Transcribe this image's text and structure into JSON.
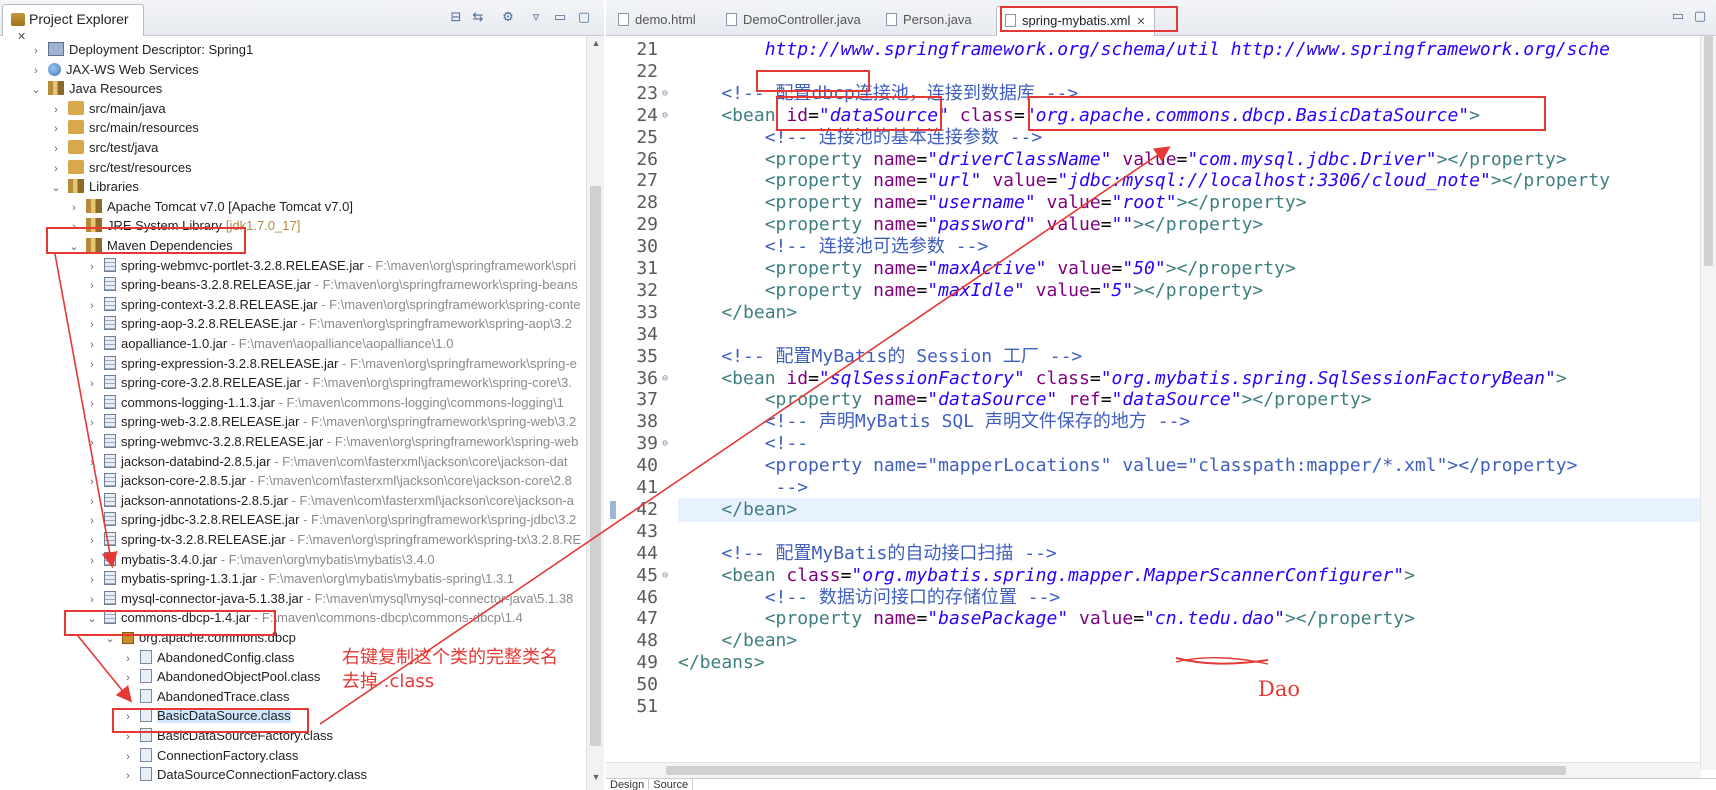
{
  "explorer": {
    "title": "Project Explorer",
    "tools": [
      "collapse-all-icon",
      "link-editor-icon",
      "filters-icon",
      "view-menu-icon",
      "minimize-icon",
      "maximize-icon"
    ],
    "rows": [
      {
        "label": "Deployment Descriptor: Spring1",
        "path": "",
        "deco": "",
        "icon": "deployment-descriptor-icon",
        "arrow": "›"
      },
      {
        "label": "JAX-WS Web Services",
        "path": "",
        "deco": "",
        "icon": "web-services-icon",
        "arrow": "›"
      },
      {
        "label": "Java Resources",
        "path": "",
        "deco": "",
        "icon": "java-resources-icon",
        "arrow": "⌄"
      },
      {
        "label": "src/main/java",
        "path": "",
        "deco": "",
        "icon": "source-folder-icon",
        "arrow": "›"
      },
      {
        "label": "src/main/resources",
        "path": "",
        "deco": "",
        "icon": "source-folder-icon",
        "arrow": "›"
      },
      {
        "label": "src/test/java",
        "path": "",
        "deco": "",
        "icon": "source-folder-icon",
        "arrow": "›"
      },
      {
        "label": "src/test/resources",
        "path": "",
        "deco": "",
        "icon": "source-folder-icon",
        "arrow": "›"
      },
      {
        "label": "Libraries",
        "path": "",
        "deco": "",
        "icon": "libraries-icon",
        "arrow": "⌄"
      },
      {
        "label": "Apache Tomcat v7.0 [Apache Tomcat v7.0]",
        "path": "",
        "deco": "",
        "icon": "library-icon",
        "arrow": "›"
      },
      {
        "label": "JRE System Library",
        "path": "",
        "deco": "[jdk1.7.0_17]",
        "icon": "library-icon",
        "arrow": "›"
      },
      {
        "label": "Maven Dependencies",
        "path": "",
        "deco": "",
        "icon": "library-icon",
        "arrow": "⌄"
      },
      {
        "label": "spring-webmvc-portlet-3.2.8.RELEASE.jar",
        "path": " - F:\\maven\\org\\springframework\\spri",
        "deco": "",
        "icon": "jar-icon",
        "arrow": "›"
      },
      {
        "label": "spring-beans-3.2.8.RELEASE.jar",
        "path": " - F:\\maven\\org\\springframework\\spring-beans",
        "deco": "",
        "icon": "jar-icon",
        "arrow": "›"
      },
      {
        "label": "spring-context-3.2.8.RELEASE.jar",
        "path": " - F:\\maven\\org\\springframework\\spring-conte",
        "deco": "",
        "icon": "jar-icon",
        "arrow": "›"
      },
      {
        "label": "spring-aop-3.2.8.RELEASE.jar",
        "path": " - F:\\maven\\org\\springframework\\spring-aop\\3.2",
        "deco": "",
        "icon": "jar-icon",
        "arrow": "›"
      },
      {
        "label": "aopalliance-1.0.jar",
        "path": " - F:\\maven\\aopalliance\\aopalliance\\1.0",
        "deco": "",
        "icon": "jar-icon",
        "arrow": "›"
      },
      {
        "label": "spring-expression-3.2.8.RELEASE.jar",
        "path": " - F:\\maven\\org\\springframework\\spring-e",
        "deco": "",
        "icon": "jar-icon",
        "arrow": "›"
      },
      {
        "label": "spring-core-3.2.8.RELEASE.jar",
        "path": " - F:\\maven\\org\\springframework\\spring-core\\3.",
        "deco": "",
        "icon": "jar-icon",
        "arrow": "›"
      },
      {
        "label": "commons-logging-1.1.3.jar",
        "path": " - F:\\maven\\commons-logging\\commons-logging\\1",
        "deco": "",
        "icon": "jar-icon",
        "arrow": "›"
      },
      {
        "label": "spring-web-3.2.8.RELEASE.jar",
        "path": " - F:\\maven\\org\\springframework\\spring-web\\3.2",
        "deco": "",
        "icon": "jar-icon",
        "arrow": "›"
      },
      {
        "label": "spring-webmvc-3.2.8.RELEASE.jar",
        "path": " - F:\\maven\\org\\springframework\\spring-web",
        "deco": "",
        "icon": "jar-icon",
        "arrow": "›"
      },
      {
        "label": "jackson-databind-2.8.5.jar",
        "path": " - F:\\maven\\com\\fasterxml\\jackson\\core\\jackson-dat",
        "deco": "",
        "icon": "jar-icon",
        "arrow": "›"
      },
      {
        "label": "jackson-core-2.8.5.jar",
        "path": " - F:\\maven\\com\\fasterxml\\jackson\\core\\jackson-core\\2.8",
        "deco": "",
        "icon": "jar-icon",
        "arrow": "›"
      },
      {
        "label": "jackson-annotations-2.8.5.jar",
        "path": " - F:\\maven\\com\\fasterxml\\jackson\\core\\jackson-a",
        "deco": "",
        "icon": "jar-icon",
        "arrow": "›"
      },
      {
        "label": "spring-jdbc-3.2.8.RELEASE.jar",
        "path": " - F:\\maven\\org\\springframework\\spring-jdbc\\3.2",
        "deco": "",
        "icon": "jar-icon",
        "arrow": "›"
      },
      {
        "label": "spring-tx-3.2.8.RELEASE.jar",
        "path": " - F:\\maven\\org\\springframework\\spring-tx\\3.2.8.RE",
        "deco": "",
        "icon": "jar-icon",
        "arrow": "›"
      },
      {
        "label": "mybatis-3.4.0.jar",
        "path": " - F:\\maven\\org\\mybatis\\mybatis\\3.4.0",
        "deco": "",
        "icon": "jar-icon",
        "arrow": "›"
      },
      {
        "label": "mybatis-spring-1.3.1.jar",
        "path": " - F:\\maven\\org\\mybatis\\mybatis-spring\\1.3.1",
        "deco": "",
        "icon": "jar-icon",
        "arrow": "›"
      },
      {
        "label": "mysql-connector-java-5.1.38.jar",
        "path": " - F:\\maven\\mysql\\mysql-connector-java\\5.1.38",
        "deco": "",
        "icon": "jar-icon",
        "arrow": "›"
      },
      {
        "label": "commons-dbcp-1.4.jar",
        "path": " - F:\\maven\\commons-dbcp\\commons-dbcp\\1.4",
        "deco": "",
        "icon": "jar-icon",
        "arrow": "⌄"
      },
      {
        "label": "org.apache.commons.dbcp",
        "path": "",
        "deco": "",
        "icon": "package-icon",
        "arrow": "⌄"
      },
      {
        "label": "AbandonedConfig.class",
        "path": "",
        "deco": "",
        "icon": "class-file-icon",
        "arrow": "›"
      },
      {
        "label": "AbandonedObjectPool.class",
        "path": "",
        "deco": "",
        "icon": "class-file-icon",
        "arrow": "›"
      },
      {
        "label": "AbandonedTrace.class",
        "path": "",
        "deco": "",
        "icon": "class-file-icon",
        "arrow": "›"
      },
      {
        "label": "BasicDataSource.class",
        "path": "",
        "deco": "",
        "icon": "class-file-icon",
        "arrow": "›"
      },
      {
        "label": "BasicDataSourceFactory.class",
        "path": "",
        "deco": "",
        "icon": "class-file-icon",
        "arrow": "›"
      },
      {
        "label": "ConnectionFactory.class",
        "path": "",
        "deco": "",
        "icon": "class-file-icon",
        "arrow": "›"
      },
      {
        "label": "DataSourceConnectionFactory.class",
        "path": "",
        "deco": "",
        "icon": "class-file-icon",
        "arrow": "›"
      }
    ]
  },
  "editor": {
    "tabs": [
      {
        "label": "demo.html",
        "active": false
      },
      {
        "label": "DemoController.java",
        "active": false
      },
      {
        "label": "Person.java",
        "active": false
      },
      {
        "label": "spring-mybatis.xml",
        "active": true
      }
    ],
    "bottom_tabs": [
      "Design",
      "Source"
    ],
    "lines": [
      {
        "n": "21",
        "fold": "",
        "cur": false,
        "segs": [
          [
            "link",
            "        http://www.springframework.org/schema/util http://www.springframework.org/sche"
          ]
        ]
      },
      {
        "n": "22",
        "fold": "",
        "cur": false,
        "segs": []
      },
      {
        "n": "23",
        "fold": "⊖",
        "cur": false,
        "segs": [
          [
            "comm",
            "    <!-- 配置dbcp连接池，连接到数据库 -->"
          ]
        ]
      },
      {
        "n": "24",
        "fold": "⊖",
        "cur": false,
        "segs": [
          [
            "tag",
            "    <bean "
          ],
          [
            "attr",
            "id"
          ],
          [
            "plain",
            "="
          ],
          [
            "str",
            "\"dataSource\""
          ],
          [
            "plain",
            " "
          ],
          [
            "attr",
            "class"
          ],
          [
            "plain",
            "="
          ],
          [
            "str",
            "\"org.apache.commons.dbcp.BasicDataSource\""
          ],
          [
            "tag",
            ">"
          ]
        ]
      },
      {
        "n": "25",
        "fold": "",
        "cur": false,
        "segs": [
          [
            "comm",
            "        <!-- 连接池的基本连接参数 -->"
          ]
        ]
      },
      {
        "n": "26",
        "fold": "",
        "cur": false,
        "segs": [
          [
            "tag",
            "        <property "
          ],
          [
            "attr",
            "name"
          ],
          [
            "plain",
            "="
          ],
          [
            "str",
            "\"driverClassName\""
          ],
          [
            "plain",
            " "
          ],
          [
            "attr",
            "value"
          ],
          [
            "plain",
            "="
          ],
          [
            "str",
            "\"com.mysql.jdbc.Driver\""
          ],
          [
            "tag",
            "></property>"
          ]
        ]
      },
      {
        "n": "27",
        "fold": "",
        "cur": false,
        "segs": [
          [
            "tag",
            "        <property "
          ],
          [
            "attr",
            "name"
          ],
          [
            "plain",
            "="
          ],
          [
            "str",
            "\"url\""
          ],
          [
            "plain",
            " "
          ],
          [
            "attr",
            "value"
          ],
          [
            "plain",
            "="
          ],
          [
            "str",
            "\"jdbc:mysql://localhost:3306/cloud_note\""
          ],
          [
            "tag",
            "></property"
          ]
        ]
      },
      {
        "n": "28",
        "fold": "",
        "cur": false,
        "segs": [
          [
            "tag",
            "        <property "
          ],
          [
            "attr",
            "name"
          ],
          [
            "plain",
            "="
          ],
          [
            "str",
            "\"username\""
          ],
          [
            "plain",
            " "
          ],
          [
            "attr",
            "value"
          ],
          [
            "plain",
            "="
          ],
          [
            "str",
            "\"root\""
          ],
          [
            "tag",
            "></property>"
          ]
        ]
      },
      {
        "n": "29",
        "fold": "",
        "cur": false,
        "segs": [
          [
            "tag",
            "        <property "
          ],
          [
            "attr",
            "name"
          ],
          [
            "plain",
            "="
          ],
          [
            "str",
            "\"password\""
          ],
          [
            "plain",
            " "
          ],
          [
            "attr",
            "value"
          ],
          [
            "plain",
            "="
          ],
          [
            "str",
            "\"\""
          ],
          [
            "tag",
            "></property>"
          ]
        ]
      },
      {
        "n": "30",
        "fold": "",
        "cur": false,
        "segs": [
          [
            "comm",
            "        <!-- 连接池可选参数 -->"
          ]
        ]
      },
      {
        "n": "31",
        "fold": "",
        "cur": false,
        "segs": [
          [
            "tag",
            "        <property "
          ],
          [
            "attr",
            "name"
          ],
          [
            "plain",
            "="
          ],
          [
            "str",
            "\"maxActive\""
          ],
          [
            "plain",
            " "
          ],
          [
            "attr",
            "value"
          ],
          [
            "plain",
            "="
          ],
          [
            "str",
            "\"50\""
          ],
          [
            "tag",
            "></property>"
          ]
        ]
      },
      {
        "n": "32",
        "fold": "",
        "cur": false,
        "segs": [
          [
            "tag",
            "        <property "
          ],
          [
            "attr",
            "name"
          ],
          [
            "plain",
            "="
          ],
          [
            "str",
            "\"maxIdle\""
          ],
          [
            "plain",
            " "
          ],
          [
            "attr",
            "value"
          ],
          [
            "plain",
            "="
          ],
          [
            "str",
            "\"5\""
          ],
          [
            "tag",
            "></property>"
          ]
        ]
      },
      {
        "n": "33",
        "fold": "",
        "cur": false,
        "segs": [
          [
            "tag",
            "    </bean>"
          ]
        ]
      },
      {
        "n": "34",
        "fold": "",
        "cur": false,
        "segs": []
      },
      {
        "n": "35",
        "fold": "",
        "cur": false,
        "segs": [
          [
            "comm",
            "    <!-- 配置MyBatis的 Session 工厂 -->"
          ]
        ]
      },
      {
        "n": "36",
        "fold": "⊖",
        "cur": false,
        "segs": [
          [
            "tag",
            "    <bean "
          ],
          [
            "attr",
            "id"
          ],
          [
            "plain",
            "="
          ],
          [
            "str",
            "\"sqlSessionFactory\""
          ],
          [
            "plain",
            " "
          ],
          [
            "attr",
            "class"
          ],
          [
            "plain",
            "="
          ],
          [
            "str",
            "\"org.mybatis.spring.SqlSessionFactoryBean\""
          ],
          [
            "tag",
            ">"
          ]
        ]
      },
      {
        "n": "37",
        "fold": "",
        "cur": false,
        "segs": [
          [
            "tag",
            "        <property "
          ],
          [
            "attr",
            "name"
          ],
          [
            "plain",
            "="
          ],
          [
            "str",
            "\"dataSource\""
          ],
          [
            "plain",
            " "
          ],
          [
            "attr",
            "ref"
          ],
          [
            "plain",
            "="
          ],
          [
            "str",
            "\"dataSource\""
          ],
          [
            "tag",
            "></property>"
          ]
        ]
      },
      {
        "n": "38",
        "fold": "",
        "cur": false,
        "segs": [
          [
            "comm",
            "        <!-- 声明MyBatis SQL 声明文件保存的地方 -->"
          ]
        ]
      },
      {
        "n": "39",
        "fold": "⊖",
        "cur": false,
        "segs": [
          [
            "comm",
            "        <!--"
          ]
        ]
      },
      {
        "n": "40",
        "fold": "",
        "cur": false,
        "segs": [
          [
            "comm",
            "        <property name=\"mapperLocations\" value=\"classpath:mapper/*.xml\"></property>"
          ]
        ]
      },
      {
        "n": "41",
        "fold": "",
        "cur": false,
        "segs": [
          [
            "comm",
            "         -->"
          ]
        ]
      },
      {
        "n": "42",
        "fold": "",
        "cur": true,
        "segs": [
          [
            "tag",
            "    </bean>"
          ]
        ]
      },
      {
        "n": "43",
        "fold": "",
        "cur": false,
        "segs": []
      },
      {
        "n": "44",
        "fold": "",
        "cur": false,
        "segs": [
          [
            "comm",
            "    <!-- 配置MyBatis的自动接口扫描 -->"
          ]
        ]
      },
      {
        "n": "45",
        "fold": "⊖",
        "cur": false,
        "segs": [
          [
            "tag",
            "    <bean "
          ],
          [
            "attr",
            "class"
          ],
          [
            "plain",
            "="
          ],
          [
            "str",
            "\"org.mybatis.spring.mapper.MapperScannerConfigurer\""
          ],
          [
            "tag",
            ">"
          ]
        ]
      },
      {
        "n": "46",
        "fold": "",
        "cur": false,
        "segs": [
          [
            "comm",
            "        <!-- 数据访问接口的存储位置 -->"
          ]
        ]
      },
      {
        "n": "47",
        "fold": "",
        "cur": false,
        "segs": [
          [
            "tag",
            "        <property "
          ],
          [
            "attr",
            "name"
          ],
          [
            "plain",
            "="
          ],
          [
            "str",
            "\"basePackage\""
          ],
          [
            "plain",
            " "
          ],
          [
            "attr",
            "value"
          ],
          [
            "plain",
            "="
          ],
          [
            "str",
            "\"cn.tedu.dao\""
          ],
          [
            "tag",
            "></property>"
          ]
        ]
      },
      {
        "n": "48",
        "fold": "",
        "cur": false,
        "segs": [
          [
            "tag",
            "    </bean>"
          ]
        ]
      },
      {
        "n": "49",
        "fold": "",
        "cur": false,
        "segs": [
          [
            "tag",
            "</beans>"
          ]
        ]
      },
      {
        "n": "50",
        "fold": "",
        "cur": false,
        "segs": []
      },
      {
        "n": "51",
        "fold": "",
        "cur": false,
        "segs": []
      }
    ]
  },
  "annotations": {
    "note_line1": "右键复制这个类的完整类名",
    "note_line2": "去掉 .class",
    "dao_note": "Dao",
    "color": "#e53935"
  }
}
